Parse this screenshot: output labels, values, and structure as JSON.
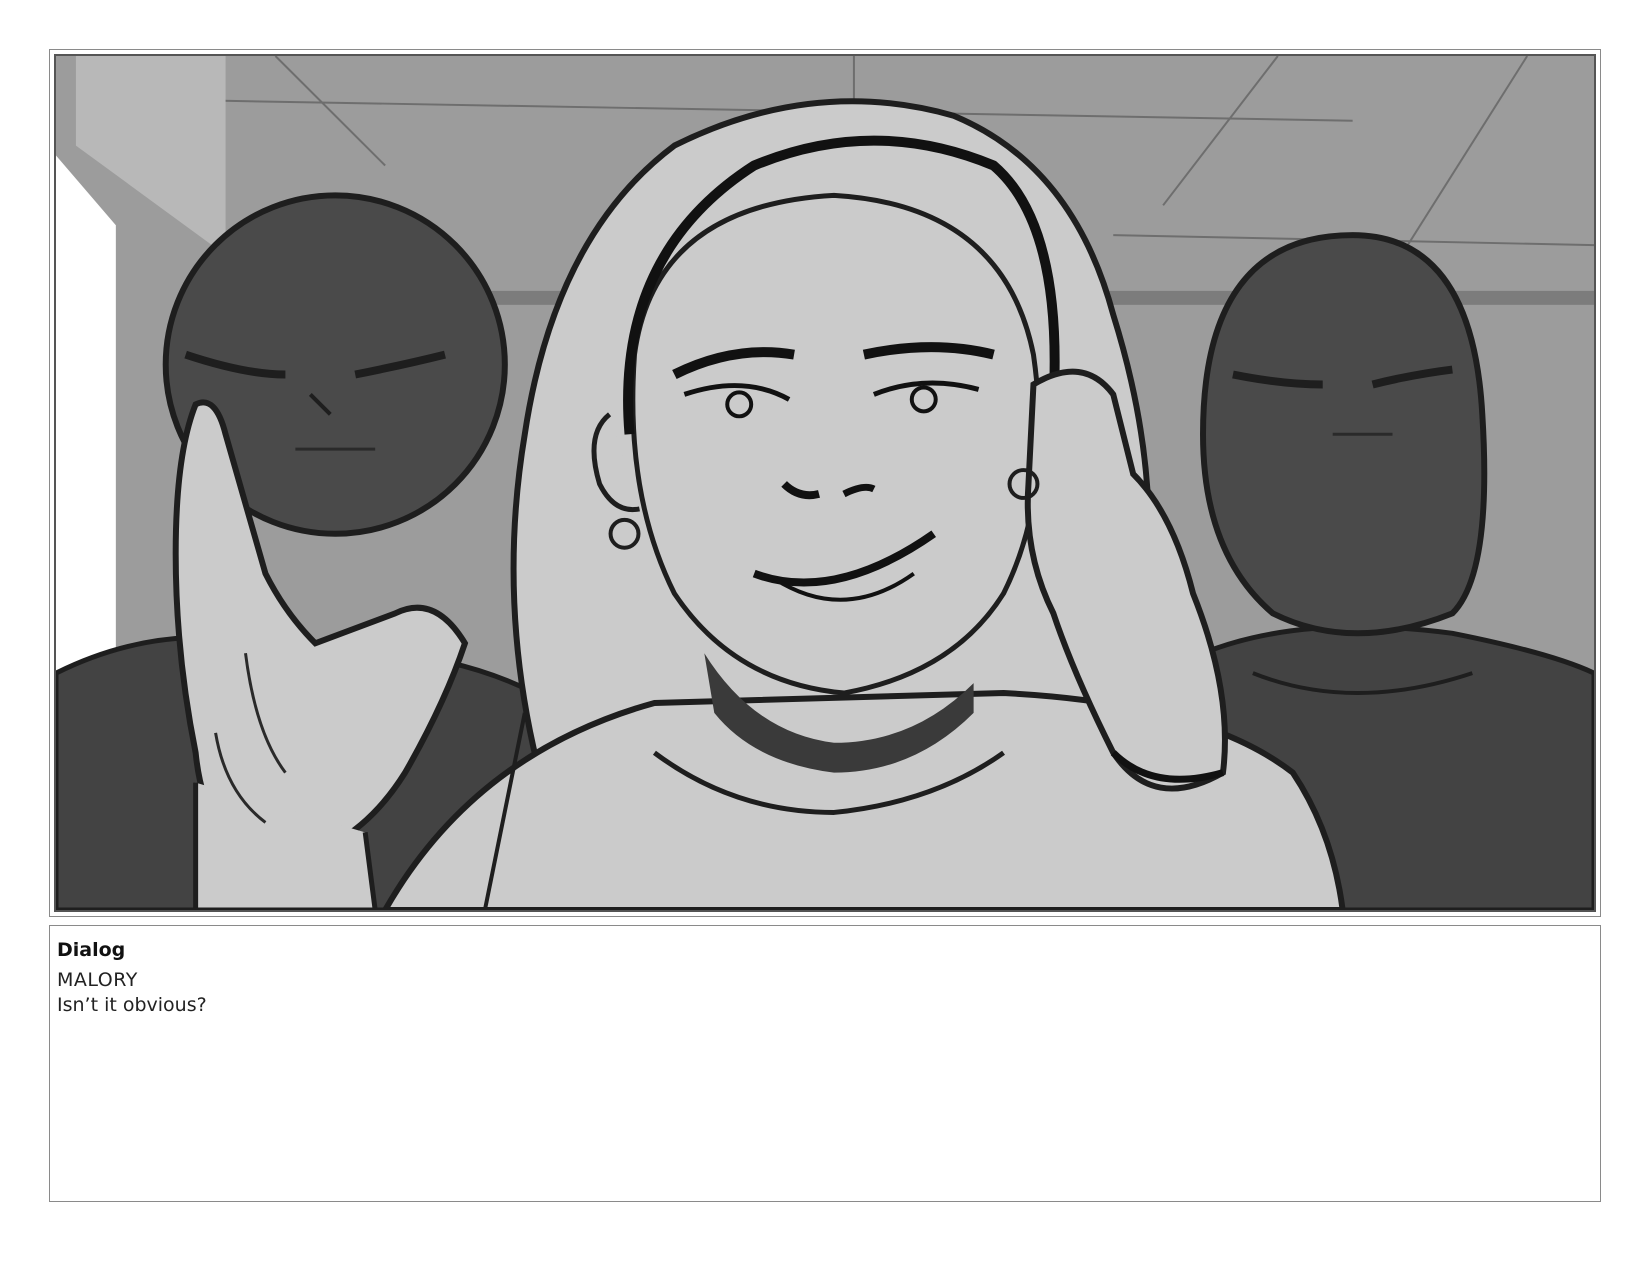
{
  "panel": {
    "image_description_name": "storyboard-sketch",
    "colors": {
      "ceiling": "#9a9a9a",
      "figure_dark": "#4a4a4a",
      "skin_light": "#cbcbcb",
      "ink": "#1e1e1e"
    }
  },
  "caption": {
    "label": "Dialog",
    "speaker": "MALORY",
    "line": "Isn’t it obvious?"
  }
}
